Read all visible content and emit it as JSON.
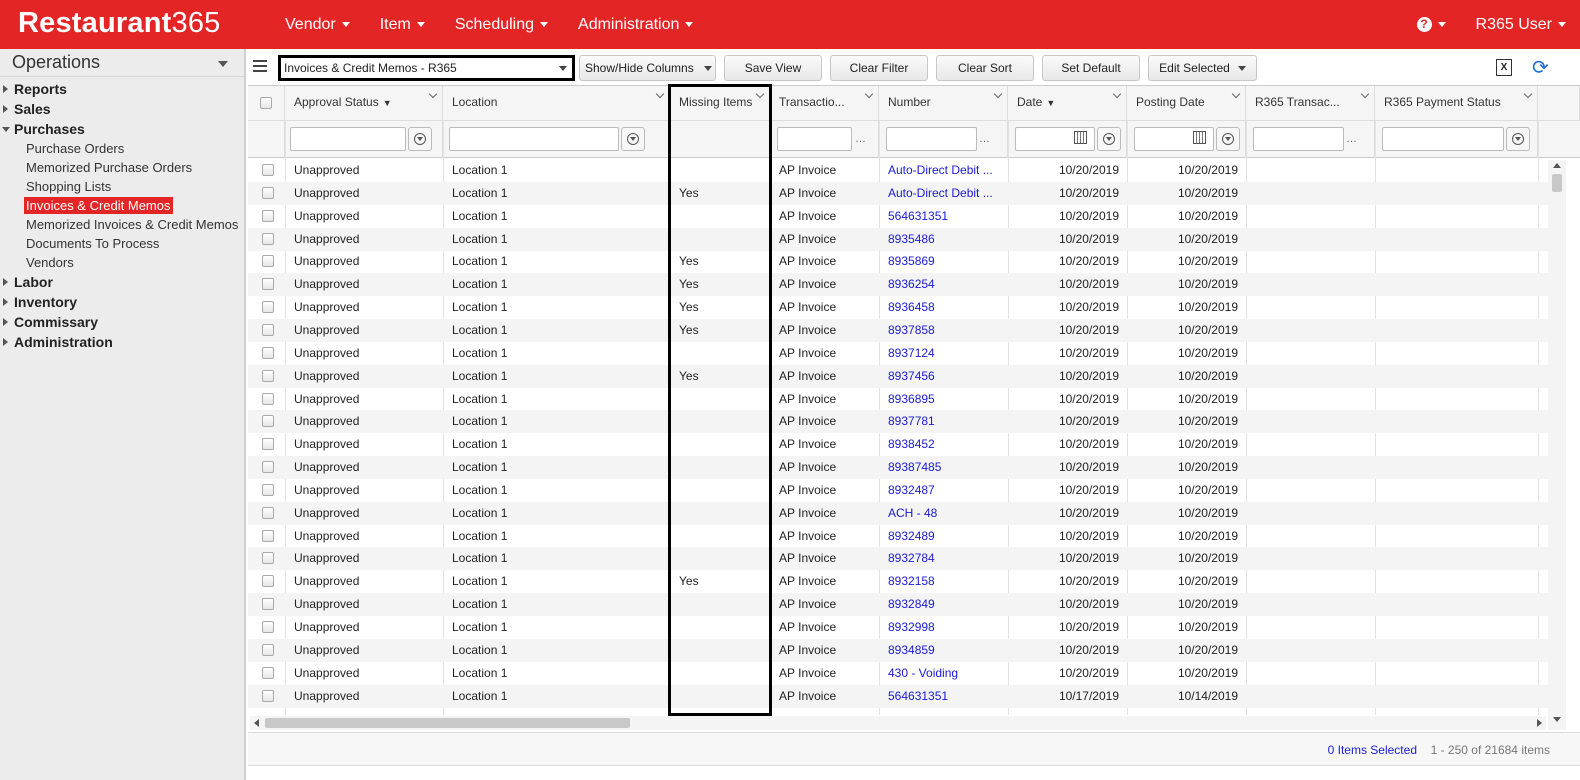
{
  "app": {
    "logo_text": "Restaurant",
    "logo_num": "365",
    "nav": [
      {
        "label": "Vendor"
      },
      {
        "label": "Item"
      },
      {
        "label": "Scheduling"
      },
      {
        "label": "Administration"
      }
    ],
    "help_icon": "question-circle-icon",
    "user_label": "R365 User",
    "brand_color": "#e42526"
  },
  "sidebar": {
    "title": "Operations",
    "groups": [
      {
        "label": "Reports"
      },
      {
        "label": "Sales"
      },
      {
        "label": "Purchases",
        "items": [
          "Purchase Orders",
          "Memorized Purchase Orders",
          "Shopping Lists",
          "Invoices & Credit Memos",
          "Memorized Invoices & Credit Memos",
          "Documents To Process",
          "Vendors"
        ]
      },
      {
        "label": "Labor"
      },
      {
        "label": "Inventory"
      },
      {
        "label": "Commissary"
      },
      {
        "label": "Administration"
      }
    ],
    "active_item": "Invoices & Credit Memos"
  },
  "toolbar": {
    "view_name": "Invoices & Credit Memos - R365",
    "show_hide": "Show/Hide Columns",
    "save_view": "Save View",
    "clear_filter": "Clear Filter",
    "clear_sort": "Clear Sort",
    "set_default": "Set Default",
    "edit_selected": "Edit Selected"
  },
  "grid": {
    "columns": [
      {
        "label": "Approval Status",
        "sorted": "desc"
      },
      {
        "label": "Location"
      },
      {
        "label": "Missing Items"
      },
      {
        "label": "Transactio..."
      },
      {
        "label": "Number"
      },
      {
        "label": "Date",
        "sorted": "desc"
      },
      {
        "label": "Posting Date"
      },
      {
        "label": "R365 Transac..."
      },
      {
        "label": "R365 Payment Status"
      }
    ],
    "rows": [
      [
        "Unapproved",
        "Location 1",
        "",
        "AP Invoice",
        "Auto-Direct Debit ...",
        "10/20/2019",
        "10/20/2019"
      ],
      [
        "Unapproved",
        "Location 1",
        "Yes",
        "AP Invoice",
        "Auto-Direct Debit ...",
        "10/20/2019",
        "10/20/2019"
      ],
      [
        "Unapproved",
        "Location 1",
        "",
        "AP Invoice",
        "564631351",
        "10/20/2019",
        "10/20/2019"
      ],
      [
        "Unapproved",
        "Location 1",
        "",
        "AP Invoice",
        "8935486",
        "10/20/2019",
        "10/20/2019"
      ],
      [
        "Unapproved",
        "Location 1",
        "Yes",
        "AP Invoice",
        "8935869",
        "10/20/2019",
        "10/20/2019"
      ],
      [
        "Unapproved",
        "Location 1",
        "Yes",
        "AP Invoice",
        "8936254",
        "10/20/2019",
        "10/20/2019"
      ],
      [
        "Unapproved",
        "Location 1",
        "Yes",
        "AP Invoice",
        "8936458",
        "10/20/2019",
        "10/20/2019"
      ],
      [
        "Unapproved",
        "Location 1",
        "Yes",
        "AP Invoice",
        "8937858",
        "10/20/2019",
        "10/20/2019"
      ],
      [
        "Unapproved",
        "Location 1",
        "",
        "AP Invoice",
        "8937124",
        "10/20/2019",
        "10/20/2019"
      ],
      [
        "Unapproved",
        "Location 1",
        "Yes",
        "AP Invoice",
        "8937456",
        "10/20/2019",
        "10/20/2019"
      ],
      [
        "Unapproved",
        "Location 1",
        "",
        "AP Invoice",
        "8936895",
        "10/20/2019",
        "10/20/2019"
      ],
      [
        "Unapproved",
        "Location 1",
        "",
        "AP Invoice",
        "8937781",
        "10/20/2019",
        "10/20/2019"
      ],
      [
        "Unapproved",
        "Location 1",
        "",
        "AP Invoice",
        "8938452",
        "10/20/2019",
        "10/20/2019"
      ],
      [
        "Unapproved",
        "Location 1",
        "",
        "AP Invoice",
        "89387485",
        "10/20/2019",
        "10/20/2019"
      ],
      [
        "Unapproved",
        "Location 1",
        "",
        "AP Invoice",
        "8932487",
        "10/20/2019",
        "10/20/2019"
      ],
      [
        "Unapproved",
        "Location 1",
        "",
        "AP Invoice",
        "ACH - 48",
        "10/20/2019",
        "10/20/2019"
      ],
      [
        "Unapproved",
        "Location 1",
        "",
        "AP Invoice",
        "8932489",
        "10/20/2019",
        "10/20/2019"
      ],
      [
        "Unapproved",
        "Location 1",
        "",
        "AP Invoice",
        "8932784",
        "10/20/2019",
        "10/20/2019"
      ],
      [
        "Unapproved",
        "Location 1",
        "Yes",
        "AP Invoice",
        "8932158",
        "10/20/2019",
        "10/20/2019"
      ],
      [
        "Unapproved",
        "Location 1",
        "",
        "AP Invoice",
        "8932849",
        "10/20/2019",
        "10/20/2019"
      ],
      [
        "Unapproved",
        "Location 1",
        "",
        "AP Invoice",
        "8932998",
        "10/20/2019",
        "10/20/2019"
      ],
      [
        "Unapproved",
        "Location 1",
        "",
        "AP Invoice",
        "8934859",
        "10/20/2019",
        "10/20/2019"
      ],
      [
        "Unapproved",
        "Location 1",
        "",
        "AP Invoice",
        "430 - Voiding",
        "10/20/2019",
        "10/20/2019"
      ],
      [
        "Unapproved",
        "Location 1",
        "",
        "AP Invoice",
        "564631351",
        "10/17/2019",
        "10/14/2019"
      ]
    ]
  },
  "footer": {
    "selected": "0 Items Selected",
    "pager": "1 - 250 of 21684 items"
  }
}
